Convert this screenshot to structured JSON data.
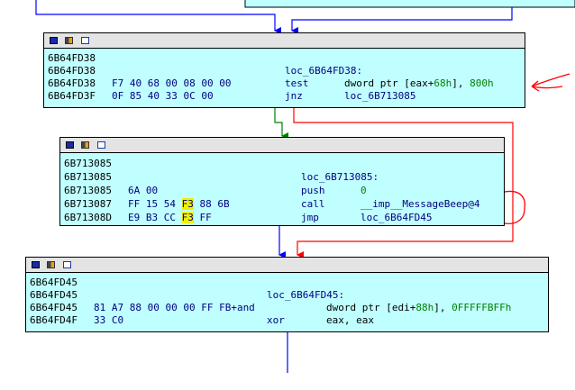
{
  "blocks": {
    "b1": {
      "lines": [
        {
          "addr": "6B64FD38"
        },
        {
          "addr": "6B64FD38",
          "label": "loc_6B64FD38:"
        },
        {
          "addr": "6B64FD38",
          "bytes": "F7 40 68 00 08 00 00",
          "mnem": "test",
          "op_a": "dword ptr [eax+",
          "op_b": "68h",
          "op_c": "], ",
          "op_d": "800h"
        },
        {
          "addr": "6B64FD3F",
          "bytes": "0F 85 40 33 0C 00",
          "mnem": "jnz",
          "op_a": "loc_6B713085"
        }
      ]
    },
    "b2": {
      "lines": [
        {
          "addr": "6B713085"
        },
        {
          "addr": "6B713085",
          "label": "loc_6B713085:"
        },
        {
          "addr": "6B713085",
          "bytes": "6A 00",
          "mnem": "push",
          "op_a": "0"
        },
        {
          "addr": "6B713087",
          "bytes_a": "FF 15 54 ",
          "bytes_hl": "F3",
          "bytes_b": " 88 6B",
          "mnem": "call",
          "op_a": "__imp__MessageBeep@4"
        },
        {
          "addr": "6B71308D",
          "bytes_a": "E9 B3 CC ",
          "bytes_hl": "F3",
          "bytes_b": " FF",
          "mnem": "jmp",
          "op_a": "loc_6B64FD45"
        }
      ]
    },
    "b3": {
      "lines": [
        {
          "addr": "6B64FD45"
        },
        {
          "addr": "6B64FD45",
          "label": "loc_6B64FD45:"
        },
        {
          "addr": "6B64FD45",
          "bytes": "81 A7 88 00 00 00 FF FB+and",
          "op_a": "dword ptr [edi+",
          "op_b": "88h",
          "op_c": "], ",
          "op_d": "0FFFFFBFFh"
        },
        {
          "addr": "6B64FD4F",
          "bytes": "33 C0",
          "mnem": "xor",
          "op_a": "eax, eax"
        }
      ]
    }
  },
  "colors": {
    "block_bg": "#c0ffff",
    "edge_blue": "#0000ff",
    "edge_red": "#ff0000",
    "edge_green": "#008000",
    "annotation_red": "#ff0000",
    "highlight": "#f0f000"
  },
  "icons": [
    "graph-color-icon",
    "graph-group-icon",
    "graph-node-icon"
  ]
}
